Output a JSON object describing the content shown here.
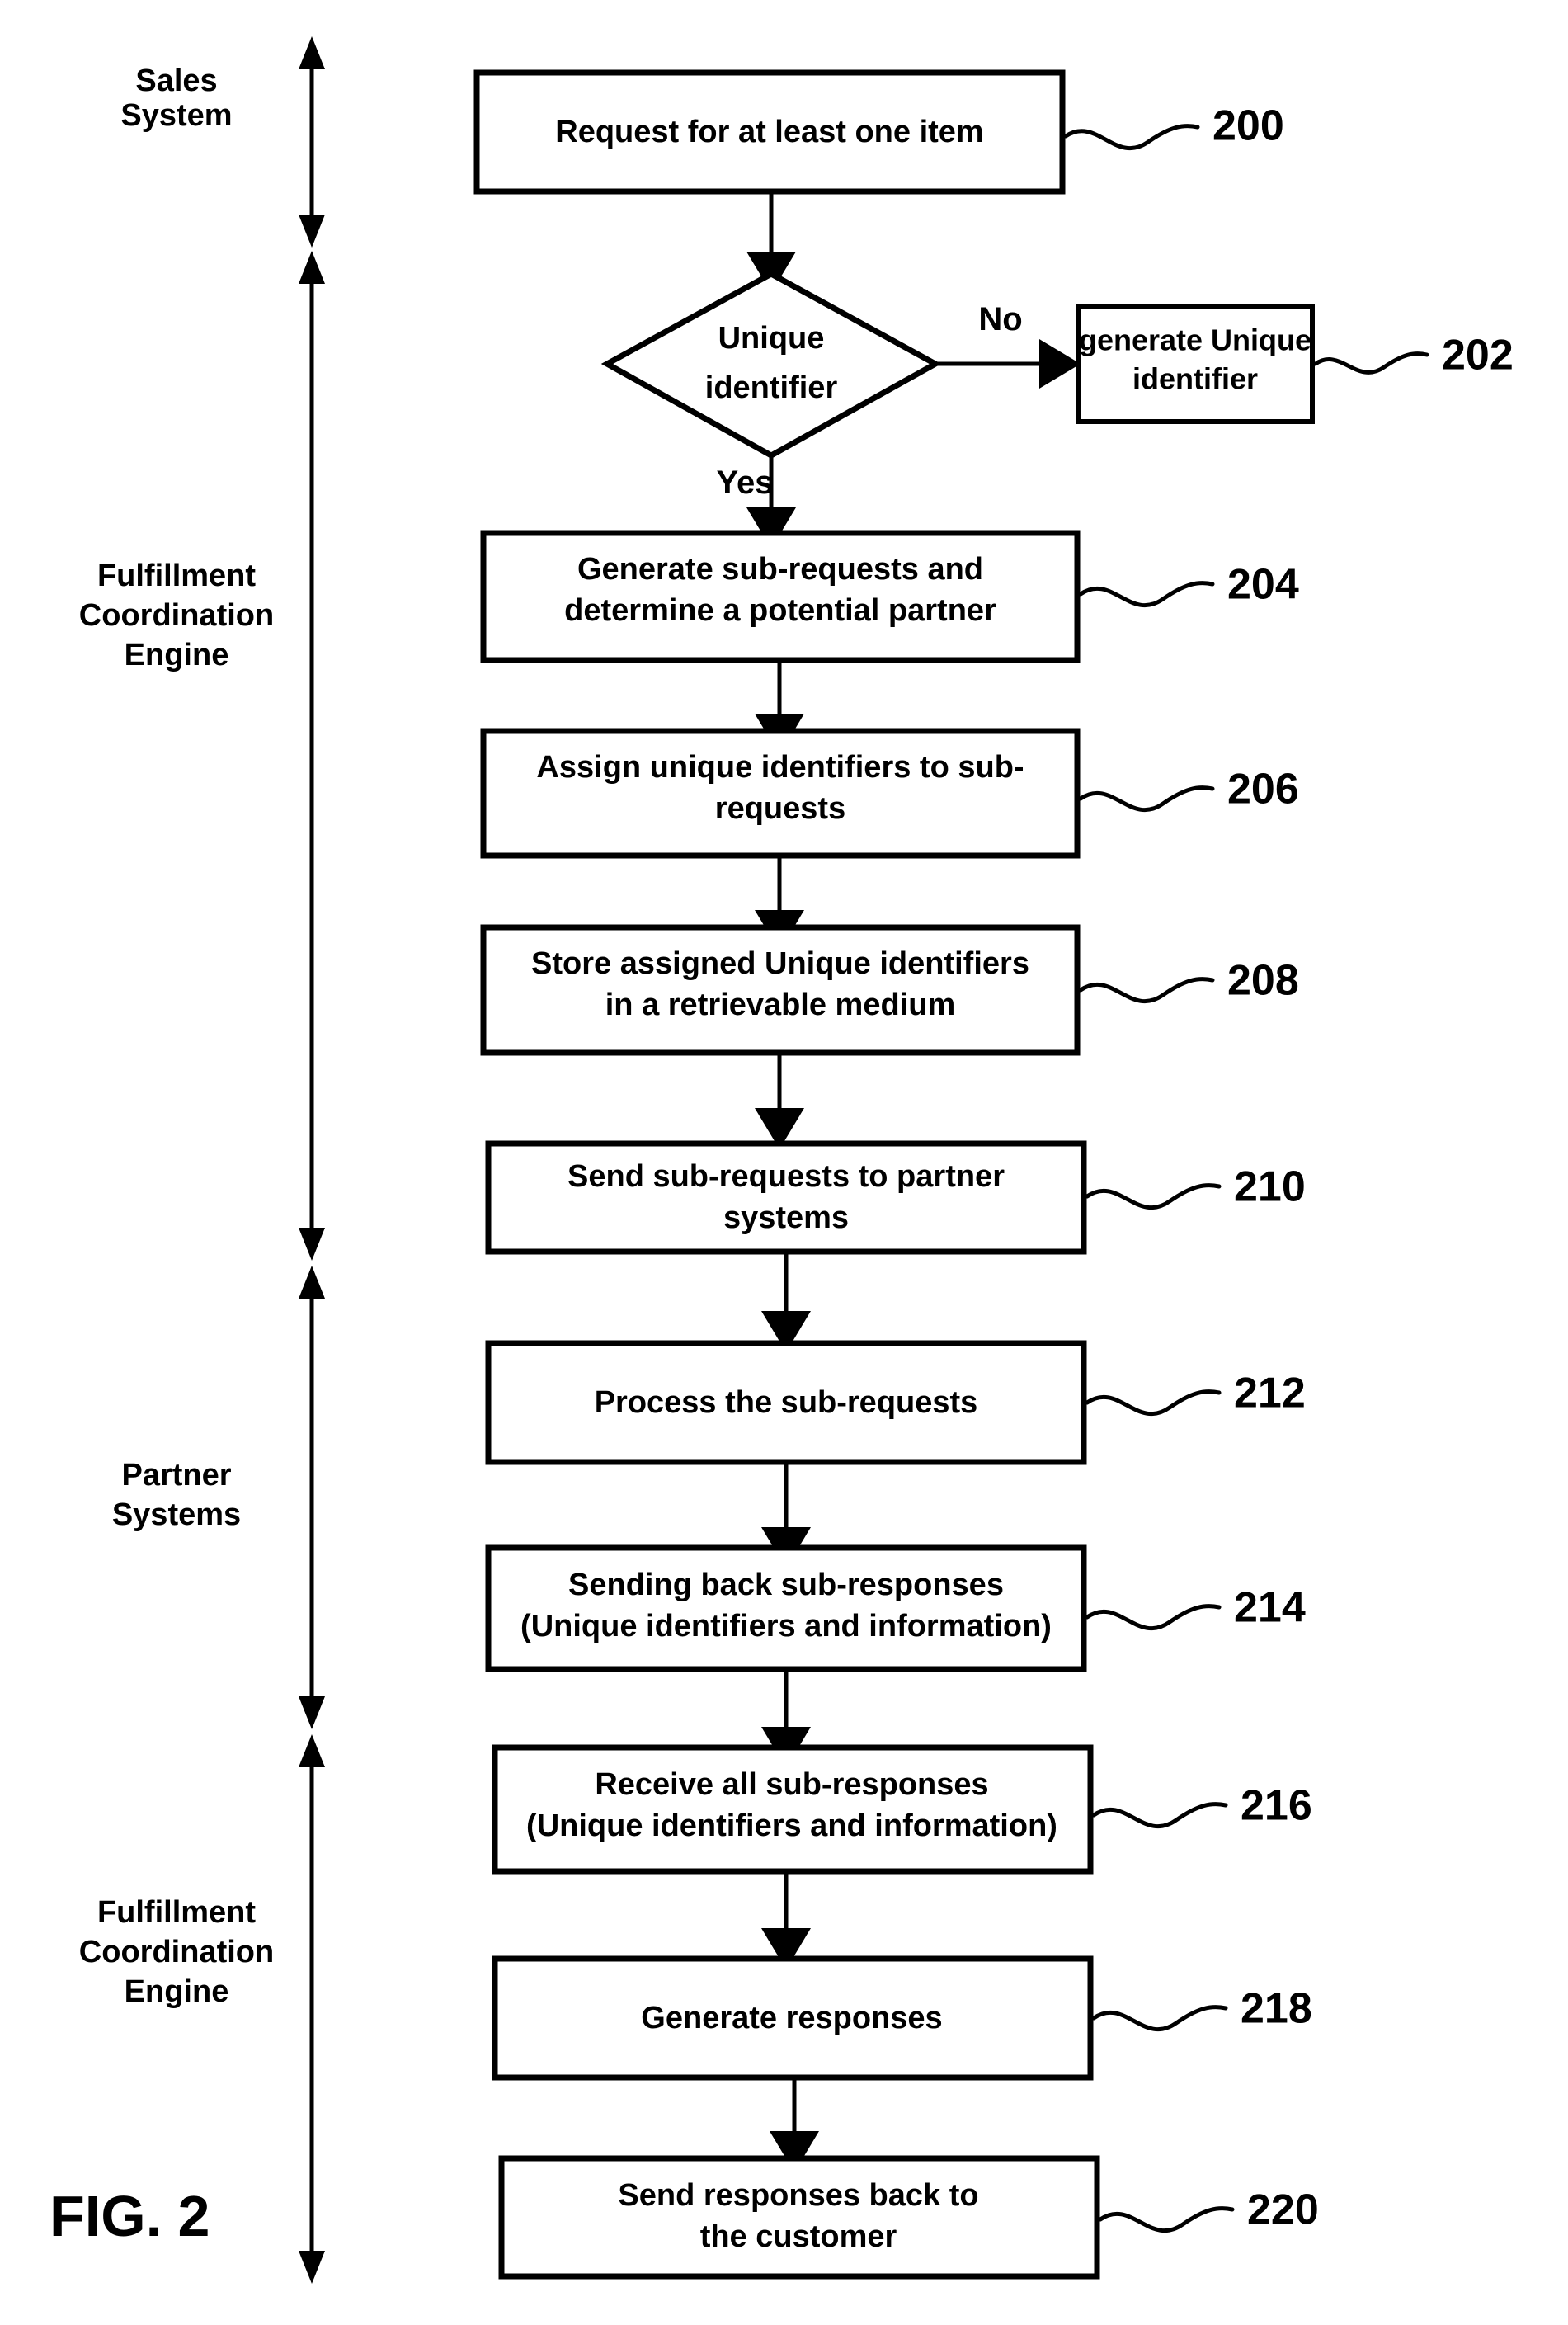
{
  "figure": {
    "label": "FIG. 2",
    "title": "Request fulfillment coordination flowchart"
  },
  "lanes": [
    {
      "id": "sales-system",
      "label_line1": "Sales",
      "label_line2": "System",
      "label_line3": ""
    },
    {
      "id": "fulfillment-coordination-engine-top",
      "label_line1": "Fulfillment",
      "label_line2": "Coordination",
      "label_line3": "Engine"
    },
    {
      "id": "partner-systems",
      "label_line1": "Partner",
      "label_line2": "Systems",
      "label_line3": ""
    },
    {
      "id": "fulfillment-coordination-engine-bottom",
      "label_line1": "Fulfillment",
      "label_line2": "Coordination",
      "label_line3": "Engine"
    }
  ],
  "nodes": [
    {
      "id": "n200",
      "ref": "200",
      "type": "process",
      "line1": "Request for at least one item",
      "line2": ""
    },
    {
      "id": "d-unique",
      "ref": "",
      "type": "decision",
      "line1": "Unique",
      "line2": "identifier"
    },
    {
      "id": "n202",
      "ref": "202",
      "type": "process",
      "line1": "generate Unique",
      "line2": "identifier"
    },
    {
      "id": "n204",
      "ref": "204",
      "type": "process",
      "line1": "Generate sub-requests and",
      "line2": "determine a potential partner"
    },
    {
      "id": "n206",
      "ref": "206",
      "type": "process",
      "line1": "Assign unique identifiers to sub-",
      "line2": "requests"
    },
    {
      "id": "n208",
      "ref": "208",
      "type": "process",
      "line1": "Store assigned Unique identifiers",
      "line2": "in a retrievable medium"
    },
    {
      "id": "n210",
      "ref": "210",
      "type": "process",
      "line1": "Send sub-requests to partner",
      "line2": "systems"
    },
    {
      "id": "n212",
      "ref": "212",
      "type": "process",
      "line1": "Process the sub-requests",
      "line2": ""
    },
    {
      "id": "n214",
      "ref": "214",
      "type": "process",
      "line1": "Sending back sub-responses",
      "line2": "(Unique identifiers and information)"
    },
    {
      "id": "n216",
      "ref": "216",
      "type": "process",
      "line1": "Receive all sub-responses",
      "line2": "(Unique identifiers and information)"
    },
    {
      "id": "n218",
      "ref": "218",
      "type": "process",
      "line1": "Generate responses",
      "line2": ""
    },
    {
      "id": "n220",
      "ref": "220",
      "type": "process",
      "line1": "Send responses back to",
      "line2": "the customer"
    }
  ],
  "branches": {
    "yes_label": "Yes",
    "no_label": "No"
  },
  "colors": {
    "ink": "#000000",
    "paper": "#ffffff"
  }
}
